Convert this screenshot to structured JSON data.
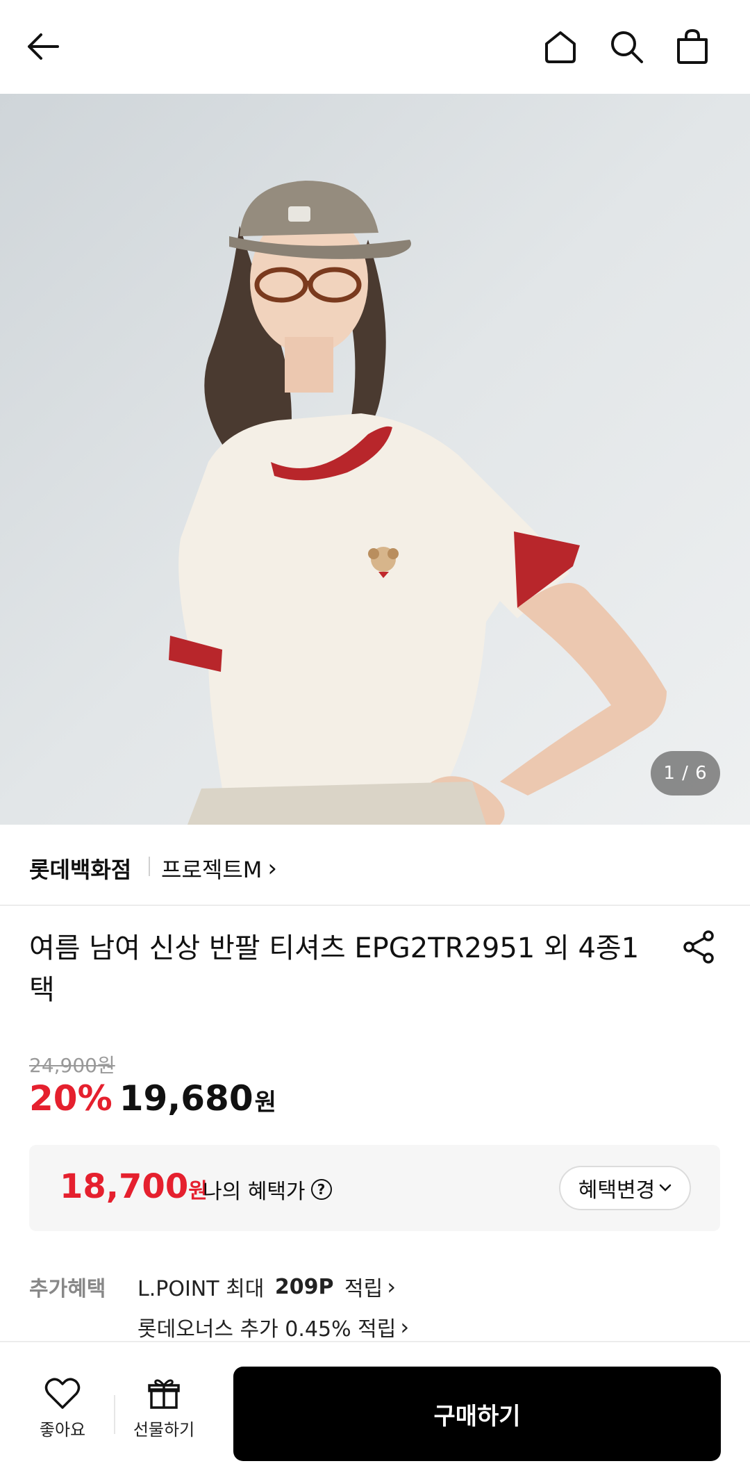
{
  "header": {
    "back_icon": "arrow-left-icon",
    "home_icon": "home-icon",
    "search_icon": "search-icon",
    "cart_icon": "shopping-bag-icon"
  },
  "gallery": {
    "current": "1",
    "total": "6",
    "counter_text": "1 / 6"
  },
  "brand": {
    "store": "롯데백화점",
    "name": "프로젝트M",
    "chevron": "›"
  },
  "product": {
    "title": "여름 남여 신상 반팔 티셔츠 EPG2TR2951 외 4종1택",
    "share_icon": "share-icon"
  },
  "price": {
    "original": "24,900원",
    "discount": "20%",
    "sale": "19,680",
    "currency": "원"
  },
  "benefit": {
    "price": "18,700",
    "currency": "원",
    "label": "나의 혜택가",
    "help": "?",
    "change_button": "혜택변경",
    "change_chevron": "⌄"
  },
  "extra_benefits": {
    "label": "추가혜택",
    "line1_prefix": "L.POINT 최대 ",
    "line1_bold": "209P",
    "line1_suffix": " 적립",
    "line2": "롯데오너스 추가 0.45% 적립",
    "chevron": "›"
  },
  "bottom_bar": {
    "like_label": "좋아요",
    "gift_label": "선물하기",
    "buy_label": "구매하기"
  },
  "colors": {
    "accent_red": "#e5202e",
    "buy_button": "#000000"
  }
}
